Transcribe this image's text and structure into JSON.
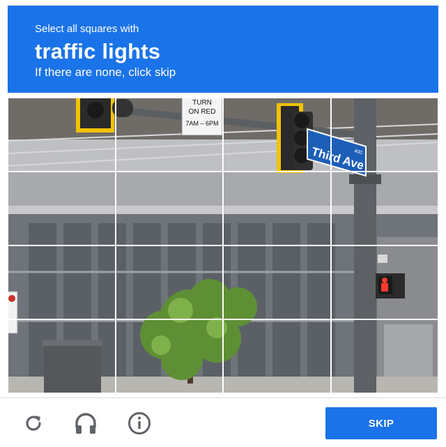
{
  "header": {
    "instruction": "Select all squares with",
    "target": "traffic lights",
    "hint": "If there are none, click skip"
  },
  "challenge": {
    "grid_rows": 4,
    "grid_cols": 4,
    "sign_turn": [
      "TURN",
      "ON RED",
      "7AM – 6PM"
    ],
    "street_sign": "Third Ave",
    "street_sign_number": "400"
  },
  "footer": {
    "reload_icon": "reload-icon",
    "audio_icon": "headphones-icon",
    "info_icon": "info-icon",
    "skip_label": "SKIP"
  },
  "colors": {
    "brand": "#1a73e8",
    "signal_yellow": "#f2c200",
    "street_sign_blue": "#1d5fb8"
  }
}
